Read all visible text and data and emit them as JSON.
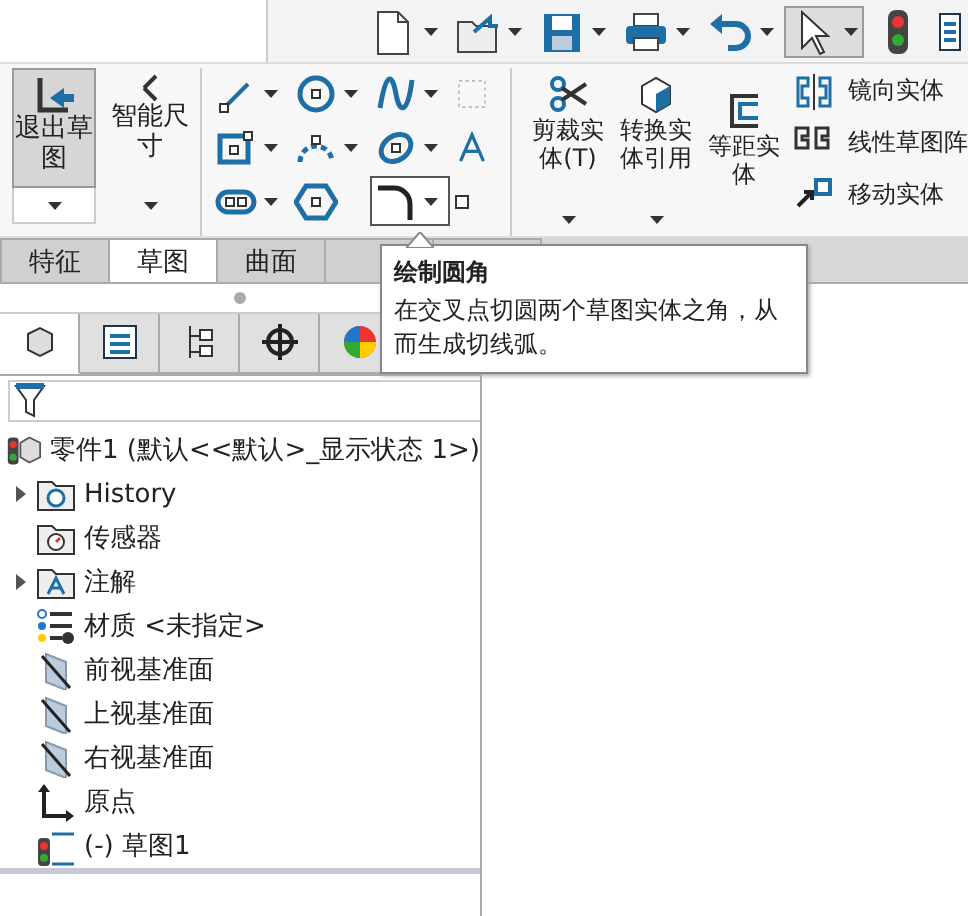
{
  "toolbar": {
    "buttons": [
      {
        "kind": "new",
        "menu": true,
        "selected": false
      },
      {
        "kind": "open",
        "menu": true,
        "selected": false
      },
      {
        "kind": "save",
        "menu": true,
        "selected": false
      },
      {
        "kind": "print",
        "menu": true,
        "selected": false
      },
      {
        "kind": "undo",
        "menu": true,
        "selected": false
      },
      {
        "kind": "select",
        "menu": true,
        "selected": true
      },
      {
        "kind": "rebuild",
        "menu": false,
        "selected": false
      },
      {
        "kind": "options",
        "menu": false,
        "selected": false
      }
    ]
  },
  "ribbon": {
    "large_buttons": [
      {
        "kind": "exit-sketch",
        "label": "退出草图",
        "selected": true
      },
      {
        "kind": "smart-dimension",
        "label": "智能尺寸",
        "selected": false
      }
    ],
    "sketch_tools": [
      {
        "kind": "line",
        "menu": true,
        "selected": false
      },
      {
        "kind": "circle",
        "menu": true,
        "selected": false
      },
      {
        "kind": "spline",
        "menu": true,
        "selected": false
      },
      {
        "kind": "grid",
        "menu": false,
        "selected": false
      },
      {
        "kind": "rectangle",
        "menu": true,
        "selected": false
      },
      {
        "kind": "arc",
        "menu": true,
        "selected": false
      },
      {
        "kind": "ellipse",
        "menu": true,
        "selected": false
      },
      {
        "kind": "text",
        "menu": false,
        "selected": false
      },
      {
        "kind": "slot",
        "menu": true,
        "selected": false
      },
      {
        "kind": "polygon",
        "menu": false,
        "selected": false
      },
      {
        "kind": "fillet",
        "menu": true,
        "selected": true
      },
      {
        "kind": "point",
        "menu": false,
        "selected": false
      }
    ],
    "modify_tools": [
      {
        "kind": "trim",
        "label": "剪裁实体(T)",
        "menu": true
      },
      {
        "kind": "convert",
        "label": "转换实体引用",
        "menu": true
      },
      {
        "kind": "offset",
        "label": "等距实体",
        "menu": false
      }
    ],
    "small_tools": [
      {
        "kind": "mirror",
        "label": "镜向实体"
      },
      {
        "kind": "pattern",
        "label": "线性草图阵"
      },
      {
        "kind": "move",
        "label": "移动实体"
      }
    ]
  },
  "tabs": [
    {
      "label": "特征",
      "selected": false
    },
    {
      "label": "草图",
      "selected": true
    },
    {
      "label": "曲面",
      "selected": false
    },
    {
      "selected": false
    },
    {
      "selected": false
    }
  ],
  "tooltip": {
    "title": "绘制圆角",
    "text": "在交叉点切圆两个草图实体之角，从而生成切线弧。"
  },
  "panel_tabs": [
    {
      "kind": "feature-tree",
      "selected": true
    },
    {
      "kind": "property",
      "selected": false
    },
    {
      "kind": "config",
      "selected": false
    },
    {
      "kind": "target",
      "selected": false
    },
    {
      "kind": "display",
      "selected": false
    }
  ],
  "tree": {
    "label": "零件1  (默认<<默认>_显示状态 1>)",
    "kind": "part",
    "children": [
      {
        "label": "History",
        "kind": "history",
        "expanded": false
      },
      {
        "label": "传感器",
        "kind": "sensor"
      },
      {
        "label": "注解",
        "kind": "annotation",
        "expanded": false
      },
      {
        "label": "材质 <未指定>",
        "kind": "material"
      },
      {
        "label": "前视基准面",
        "kind": "plane"
      },
      {
        "label": "上视基准面",
        "kind": "plane"
      },
      {
        "label": "右视基准面",
        "kind": "plane"
      },
      {
        "label": "原点",
        "kind": "origin"
      },
      {
        "label": "(-) 草图1",
        "kind": "sketch"
      }
    ]
  }
}
